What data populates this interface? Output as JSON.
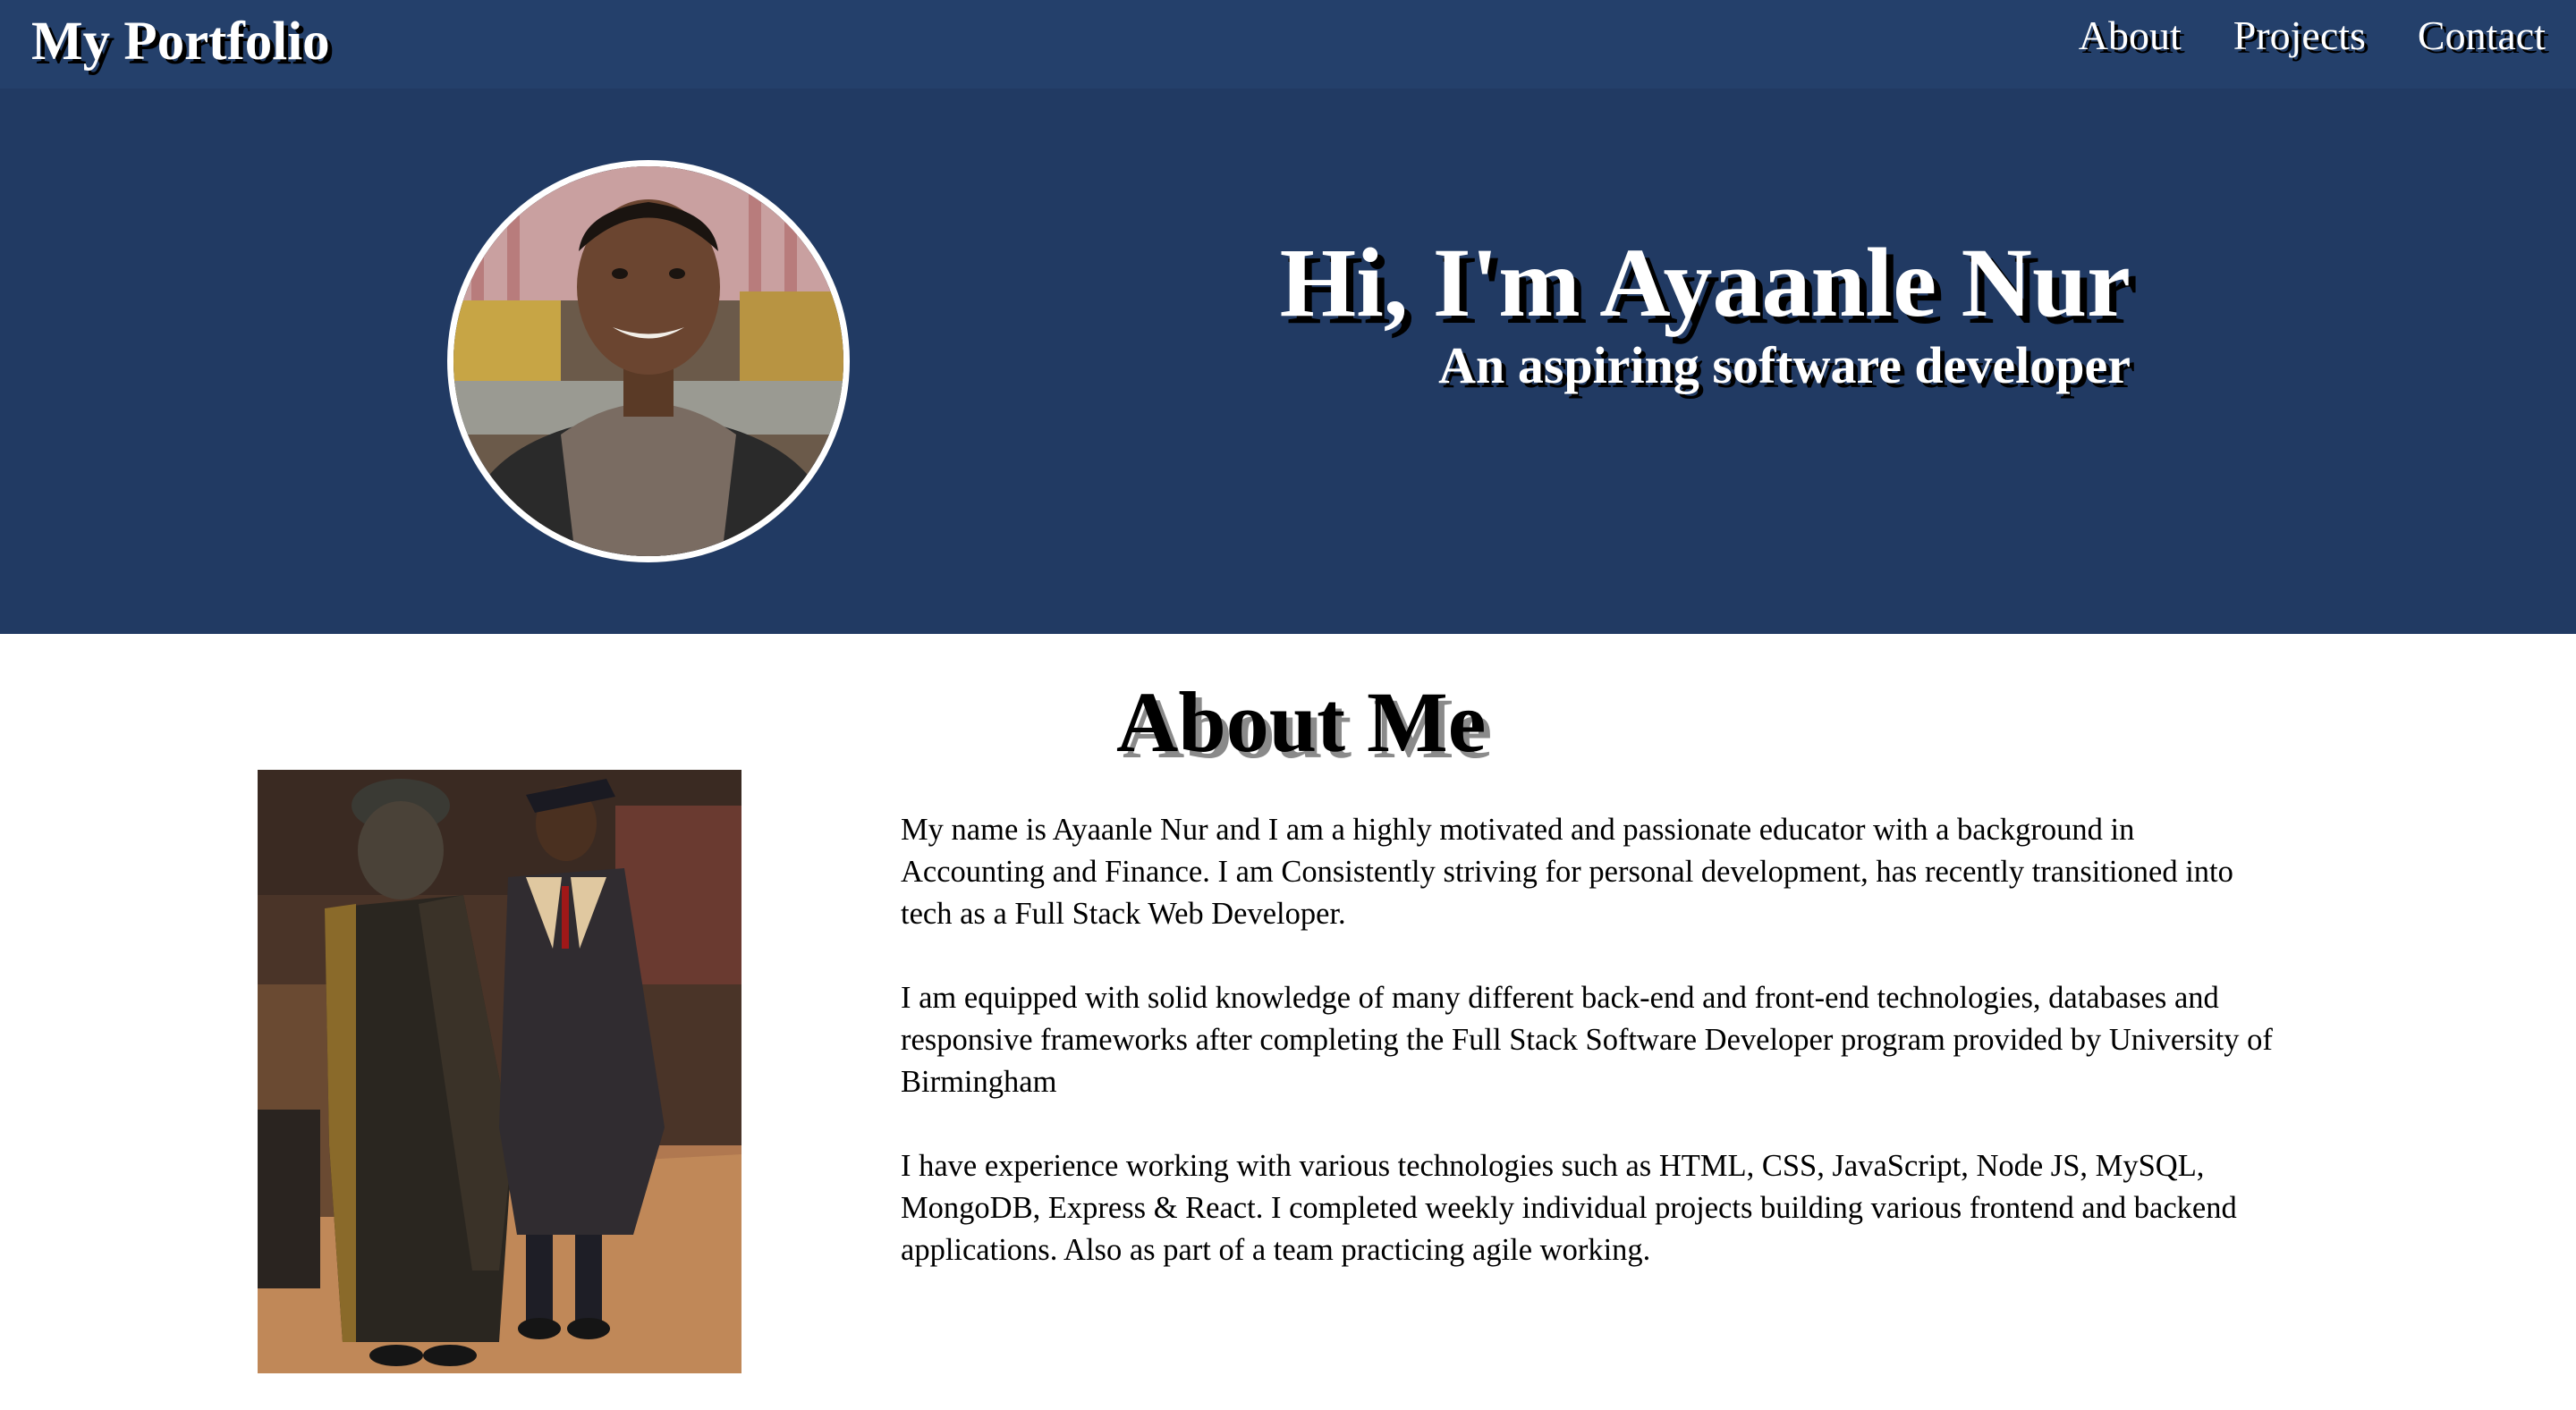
{
  "navbar": {
    "brand": "My Portfolio",
    "links": [
      {
        "label": "About"
      },
      {
        "label": "Projects"
      },
      {
        "label": "Contact"
      }
    ]
  },
  "hero": {
    "title": "Hi, I'm Ayaanle Nur",
    "subtitle": "An aspiring software developer"
  },
  "about": {
    "heading": "About Me",
    "paragraphs": [
      "My name is Ayaanle Nur and I am a highly motivated and passionate educator with a background in Accounting and Finance. I am Consistently striving for personal development, has recently transitioned into tech as a Full Stack Web Developer.",
      "I am equipped with solid knowledge of many different back-end and front-end technologies, databases and responsive frameworks after completing the Full Stack Software Developer program provided by University of Birmingham",
      "I have experience working with various technologies such as HTML, CSS, JavaScript, Node JS, MySQL, MongoDB, Express & React. I completed weekly individual projects building various frontend and backend applications. Also as part of a team practicing agile working."
    ]
  },
  "colors": {
    "navbar_bg": "#24406b",
    "hero_bg": "#213a63",
    "text_light": "#ffffff",
    "shadow": "#000000"
  }
}
